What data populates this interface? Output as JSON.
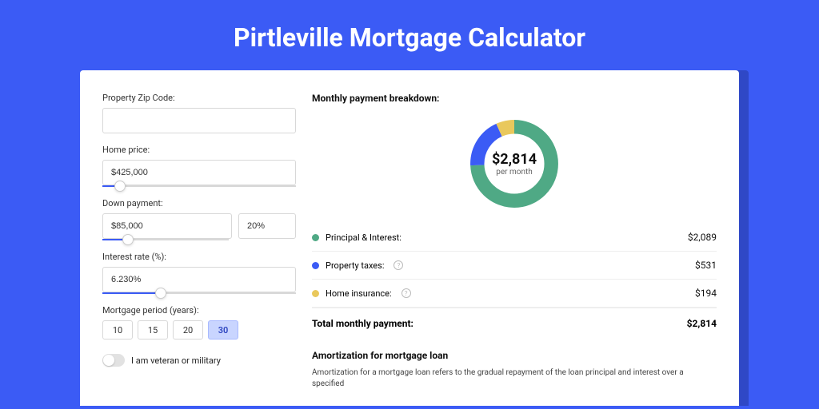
{
  "page": {
    "title": "Pirtleville Mortgage Calculator"
  },
  "form": {
    "zip_label": "Property Zip Code:",
    "zip_value": "",
    "home_price_label": "Home price:",
    "home_price_value": "$425,000",
    "home_price_slider_pct": 9,
    "down_payment_label": "Down payment:",
    "down_payment_value": "$85,000",
    "down_payment_pct_value": "20%",
    "down_payment_slider_pct": 20,
    "interest_rate_label": "Interest rate (%):",
    "interest_rate_value": "6.230%",
    "interest_rate_slider_pct": 30,
    "period_label": "Mortgage period (years):",
    "periods": [
      "10",
      "15",
      "20",
      "30"
    ],
    "period_selected": "30",
    "veteran_label": "I am veteran or military"
  },
  "breakdown": {
    "title": "Monthly payment breakdown:",
    "center_amount": "$2,814",
    "center_sub": "per month",
    "items": [
      {
        "label": "Principal & Interest:",
        "value": "$2,089",
        "color": "green",
        "help": false
      },
      {
        "label": "Property taxes:",
        "value": "$531",
        "color": "blue",
        "help": true
      },
      {
        "label": "Home insurance:",
        "value": "$194",
        "color": "yellow",
        "help": true
      }
    ],
    "total_label": "Total monthly payment:",
    "total_value": "$2,814"
  },
  "amortization": {
    "title": "Amortization for mortgage loan",
    "text": "Amortization for a mortgage loan refers to the gradual repayment of the loan principal and interest over a specified"
  },
  "chart_data": {
    "type": "pie",
    "title": "Monthly payment breakdown",
    "series": [
      {
        "name": "Principal & Interest",
        "value": 2089,
        "color": "#4fa985"
      },
      {
        "name": "Property taxes",
        "value": 531,
        "color": "#3b5bf5"
      },
      {
        "name": "Home insurance",
        "value": 194,
        "color": "#e9c85c"
      }
    ],
    "total": 2814,
    "center_label": "$2,814 per month"
  }
}
